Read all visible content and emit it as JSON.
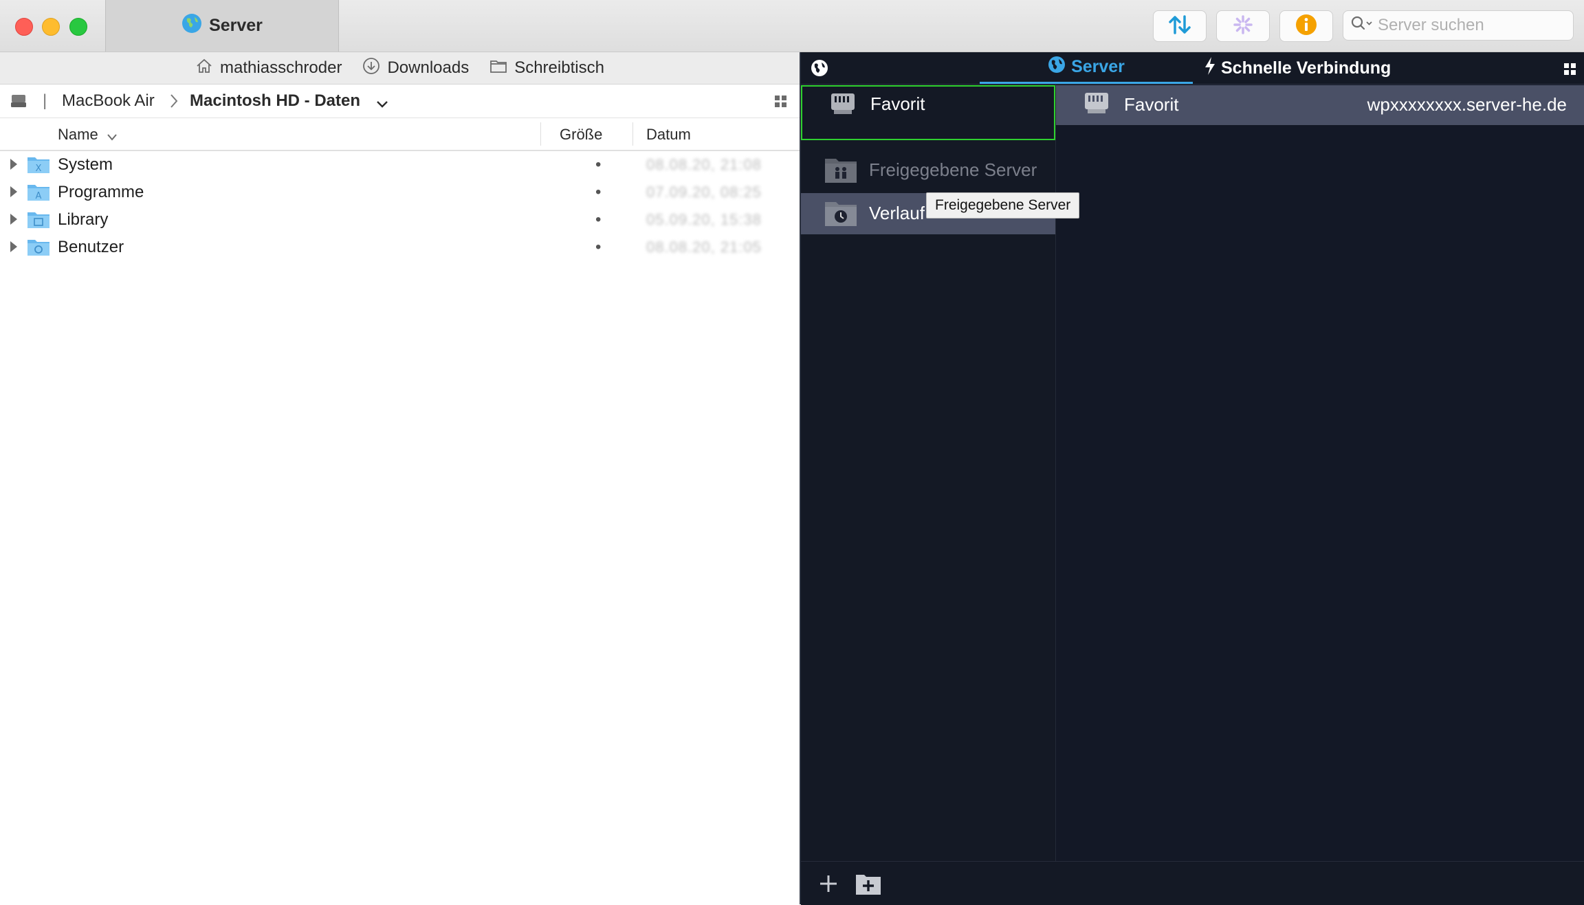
{
  "window": {
    "tab_title": "Server",
    "search_placeholder": "Server suchen"
  },
  "favorites_bar": {
    "items": [
      {
        "label": "mathiasschroder",
        "icon": "home-icon"
      },
      {
        "label": "Downloads",
        "icon": "download-icon"
      },
      {
        "label": "Schreibtisch",
        "icon": "folder-icon"
      }
    ]
  },
  "path": {
    "device": "MacBook Air",
    "volume": "Macintosh HD - Daten"
  },
  "file_list": {
    "columns": {
      "name": "Name",
      "size": "Größe",
      "date": "Datum"
    },
    "rows": [
      {
        "name": "System",
        "size": "•",
        "date": "08.08.20, 21:08"
      },
      {
        "name": "Programme",
        "size": "•",
        "date": "07.09.20, 08:25"
      },
      {
        "name": "Library",
        "size": "•",
        "date": "05.09.20, 15:38"
      },
      {
        "name": "Benutzer",
        "size": "•",
        "date": "08.08.20, 21:05"
      }
    ]
  },
  "server_panel": {
    "tabs": {
      "server": "Server",
      "quick_connect": "Schnelle Verbindung"
    },
    "sidebar": {
      "favorit": "Favorit",
      "shared": "Freigegebene Server",
      "history": "Verlauf"
    },
    "tooltip": "Freigegebene Server",
    "detail_row": {
      "name": "Favorit",
      "host": "wpxxxxxxxx.server-he.de"
    }
  },
  "colors": {
    "accent_blue": "#3aa6e6",
    "selection_border": "#2fd12f",
    "dark_bg": "#141925",
    "row_highlight": "#4a5066"
  }
}
